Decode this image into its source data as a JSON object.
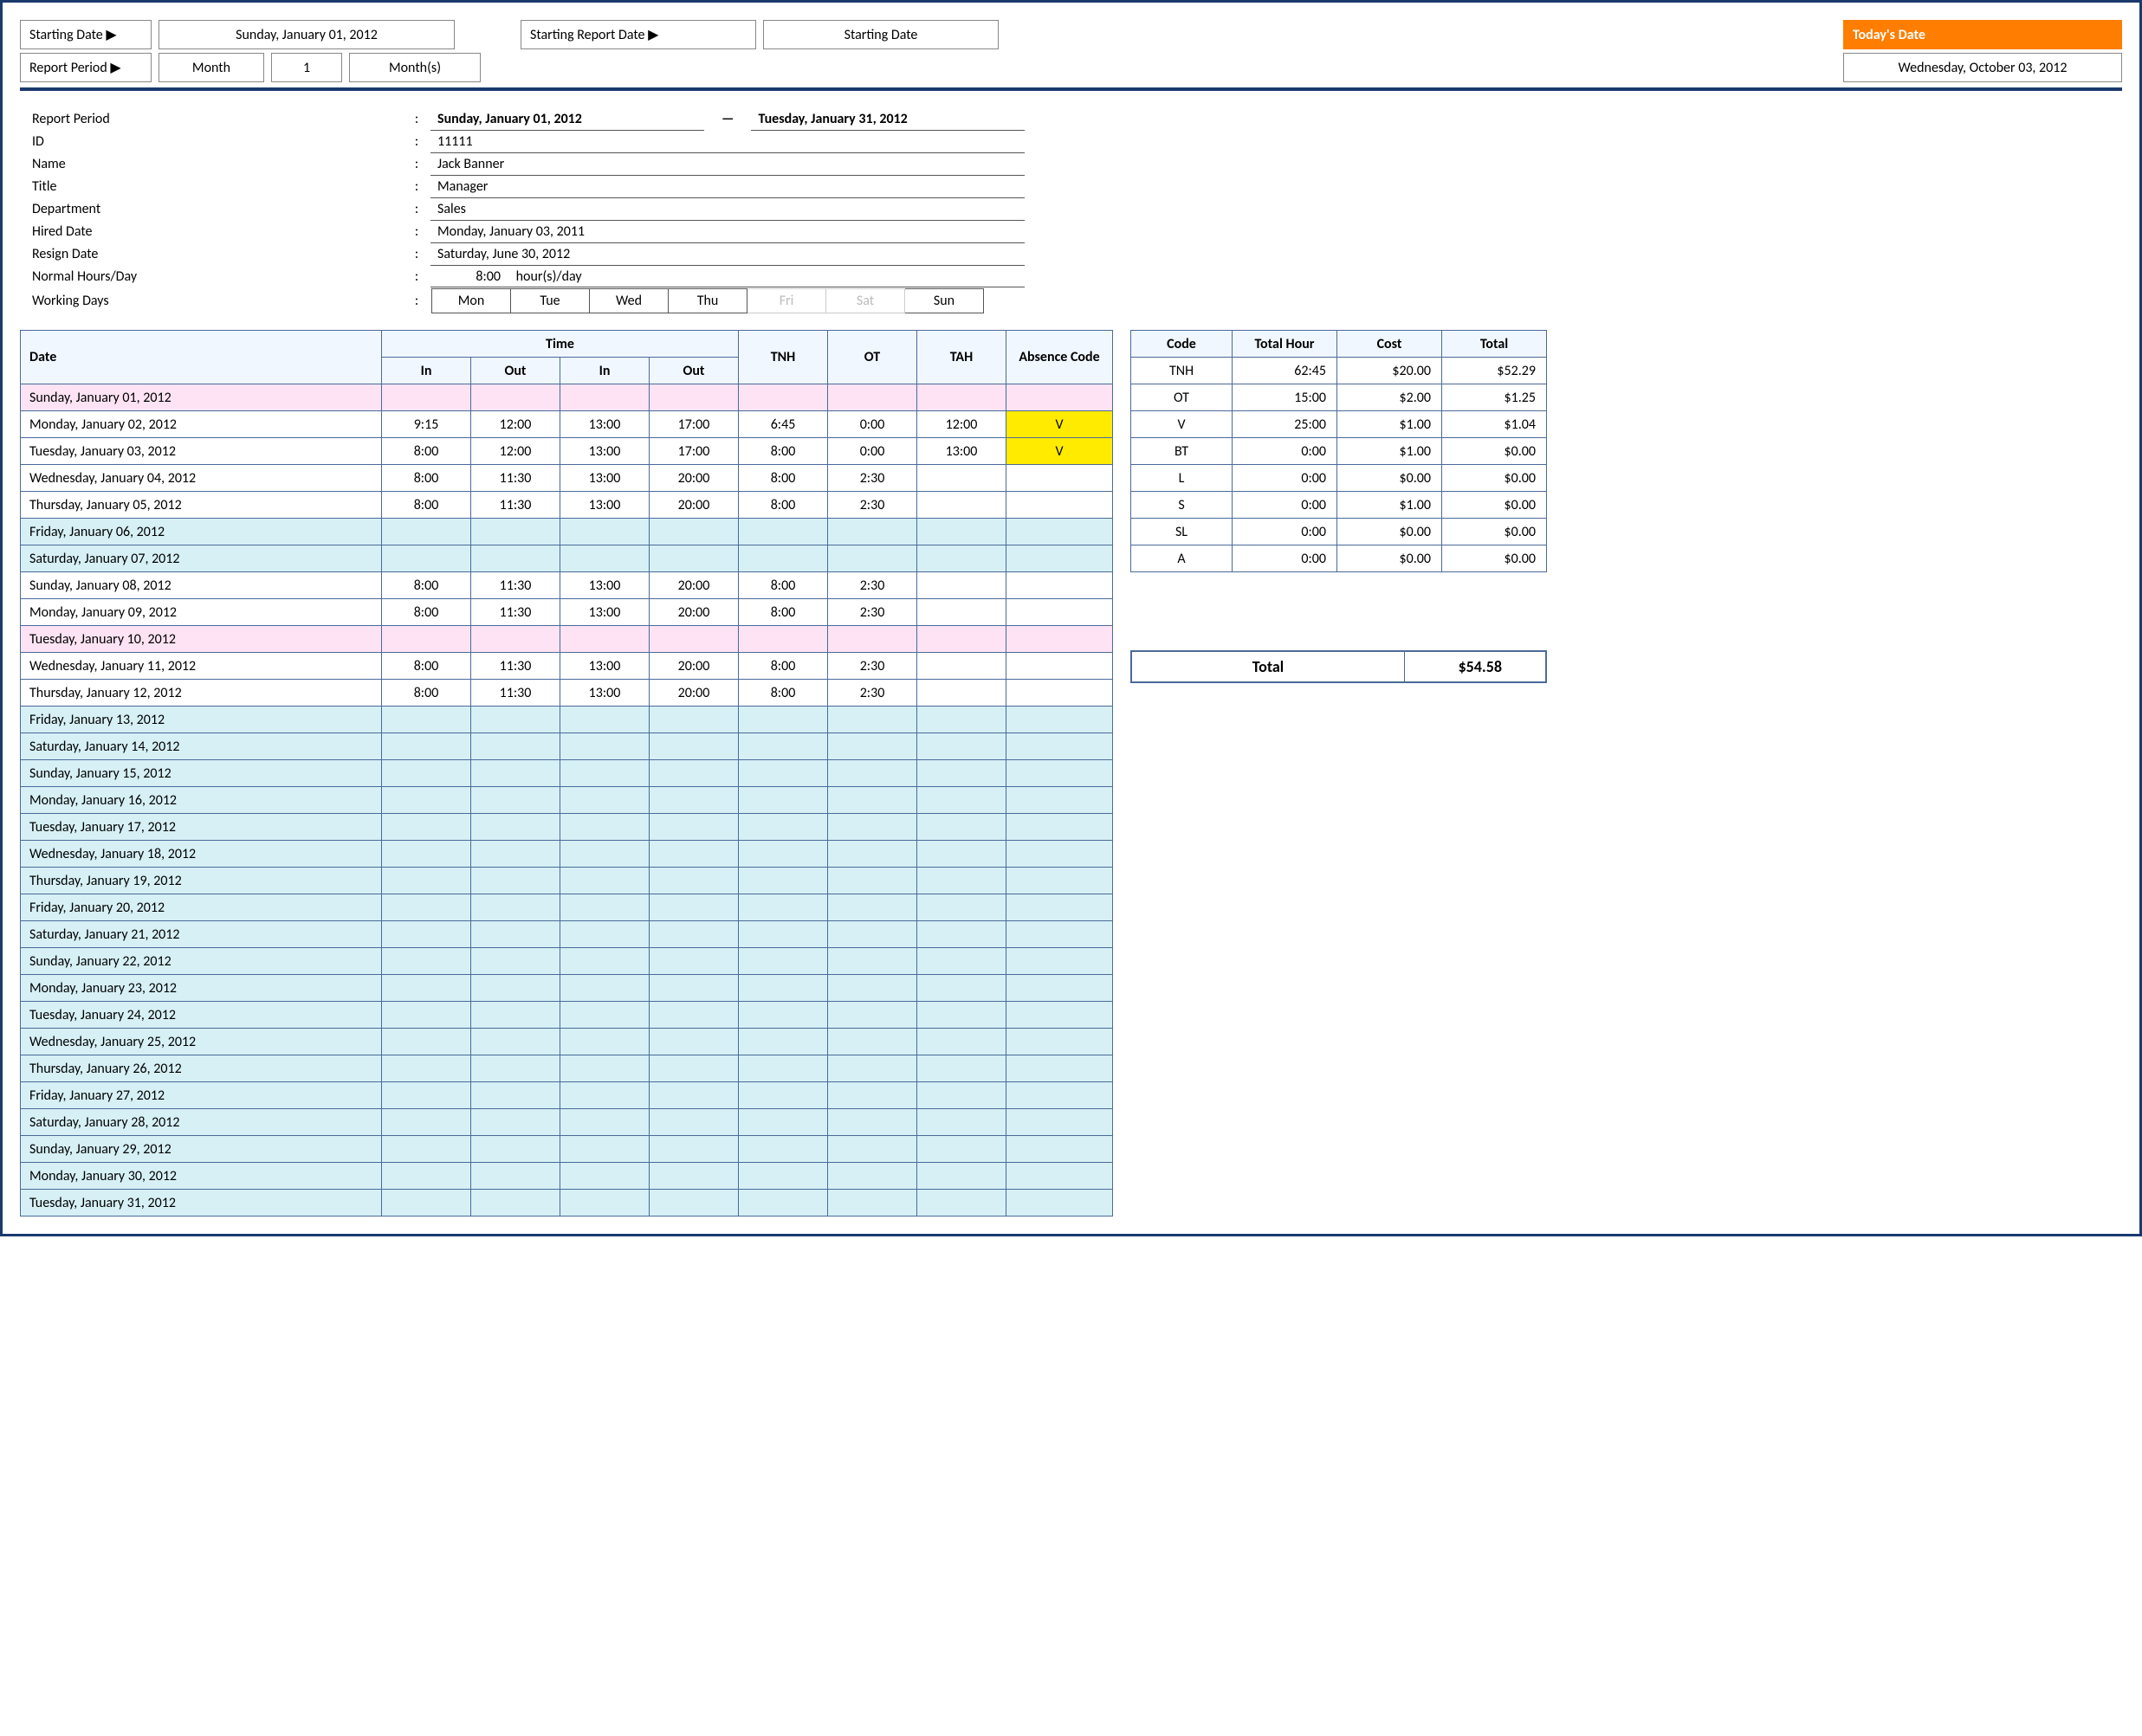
{
  "top": {
    "startLbl": "Starting Date ▶",
    "startVal": "Sunday, January 01, 2012",
    "reportDateLbl": "Starting Report Date ▶",
    "reportDateVal": "Starting Date",
    "periodLbl": "Report Period ▶",
    "periodUnit": "Month",
    "periodNum": "1",
    "periodSuffix": "Month(s)",
    "todayLbl": "Today's Date",
    "todayVal": "Wednesday, October 03, 2012"
  },
  "info": {
    "period_lbl": "Report Period",
    "period_from": "Sunday, January 01, 2012",
    "period_dash": "—",
    "period_to": "Tuesday, January 31, 2012",
    "id_lbl": "ID",
    "id_val": "11111",
    "name_lbl": "Name",
    "name_val": "Jack Banner",
    "title_lbl": "Title",
    "title_val": "Manager",
    "dept_lbl": "Department",
    "dept_val": "Sales",
    "hired_lbl": "Hired Date",
    "hired_val": "Monday, January 03, 2011",
    "resign_lbl": "Resign Date",
    "resign_val": "Saturday, June 30, 2012",
    "normhrs_lbl": "Normal Hours/Day",
    "normhrs_val": "8:00",
    "normhrs_unit": "hour(s)/day",
    "wd_lbl": "Working Days",
    "days": [
      "Mon",
      "Tue",
      "Wed",
      "Thu",
      "Fri",
      "Sat",
      "Sun"
    ]
  },
  "ts": {
    "hdr": {
      "date": "Date",
      "time": "Time",
      "in": "In",
      "out": "Out",
      "tnh": "TNH",
      "ot": "OT",
      "tah": "TAH",
      "abs": "Absence Code"
    },
    "rows": [
      {
        "d": "Sunday, January 01, 2012",
        "cls": "row-pink"
      },
      {
        "d": "Monday, January 02, 2012",
        "in1": "9:15",
        "out1": "12:00",
        "in2": "13:00",
        "out2": "17:00",
        "tnh": "6:45",
        "ot": "0:00",
        "tah": "12:00",
        "abs": "V",
        "yel": true
      },
      {
        "d": "Tuesday, January 03, 2012",
        "in1": "8:00",
        "out1": "12:00",
        "in2": "13:00",
        "out2": "17:00",
        "tnh": "8:00",
        "ot": "0:00",
        "tah": "13:00",
        "abs": "V",
        "yel": true
      },
      {
        "d": "Wednesday, January 04, 2012",
        "in1": "8:00",
        "out1": "11:30",
        "in2": "13:00",
        "out2": "20:00",
        "tnh": "8:00",
        "ot": "2:30"
      },
      {
        "d": "Thursday, January 05, 2012",
        "in1": "8:00",
        "out1": "11:30",
        "in2": "13:00",
        "out2": "20:00",
        "tnh": "8:00",
        "ot": "2:30"
      },
      {
        "d": "Friday, January 06, 2012",
        "cls": "row-cyan"
      },
      {
        "d": "Saturday, January 07, 2012",
        "cls": "row-cyan"
      },
      {
        "d": "Sunday, January 08, 2012",
        "in1": "8:00",
        "out1": "11:30",
        "in2": "13:00",
        "out2": "20:00",
        "tnh": "8:00",
        "ot": "2:30"
      },
      {
        "d": "Monday, January 09, 2012",
        "in1": "8:00",
        "out1": "11:30",
        "in2": "13:00",
        "out2": "20:00",
        "tnh": "8:00",
        "ot": "2:30"
      },
      {
        "d": "Tuesday, January 10, 2012",
        "cls": "row-pink"
      },
      {
        "d": "Wednesday, January 11, 2012",
        "in1": "8:00",
        "out1": "11:30",
        "in2": "13:00",
        "out2": "20:00",
        "tnh": "8:00",
        "ot": "2:30"
      },
      {
        "d": "Thursday, January 12, 2012",
        "in1": "8:00",
        "out1": "11:30",
        "in2": "13:00",
        "out2": "20:00",
        "tnh": "8:00",
        "ot": "2:30"
      },
      {
        "d": "Friday, January 13, 2012",
        "cls": "row-cyan"
      },
      {
        "d": "Saturday, January 14, 2012",
        "cls": "row-cyan"
      },
      {
        "d": "Sunday, January 15, 2012",
        "cls": "row-cyan"
      },
      {
        "d": "Monday, January 16, 2012",
        "cls": "row-cyan"
      },
      {
        "d": "Tuesday, January 17, 2012",
        "cls": "row-cyan"
      },
      {
        "d": "Wednesday, January 18, 2012",
        "cls": "row-cyan"
      },
      {
        "d": "Thursday, January 19, 2012",
        "cls": "row-cyan"
      },
      {
        "d": "Friday, January 20, 2012",
        "cls": "row-cyan"
      },
      {
        "d": "Saturday, January 21, 2012",
        "cls": "row-cyan"
      },
      {
        "d": "Sunday, January 22, 2012",
        "cls": "row-cyan"
      },
      {
        "d": "Monday, January 23, 2012",
        "cls": "row-cyan"
      },
      {
        "d": "Tuesday, January 24, 2012",
        "cls": "row-cyan"
      },
      {
        "d": "Wednesday, January 25, 2012",
        "cls": "row-cyan"
      },
      {
        "d": "Thursday, January 26, 2012",
        "cls": "row-cyan"
      },
      {
        "d": "Friday, January 27, 2012",
        "cls": "row-cyan"
      },
      {
        "d": "Saturday, January 28, 2012",
        "cls": "row-cyan"
      },
      {
        "d": "Sunday, January 29, 2012",
        "cls": "row-cyan"
      },
      {
        "d": "Monday, January 30, 2012",
        "cls": "row-cyan"
      },
      {
        "d": "Tuesday, January 31, 2012",
        "cls": "row-cyan"
      }
    ]
  },
  "sum": {
    "hdr": {
      "code": "Code",
      "hour": "Total Hour",
      "cost": "Cost",
      "total": "Total"
    },
    "rows": [
      {
        "c": "TNH",
        "h": "62:45",
        "cost": "$20.00",
        "t": "$52.29"
      },
      {
        "c": "OT",
        "h": "15:00",
        "cost": "$2.00",
        "t": "$1.25"
      },
      {
        "c": "V",
        "h": "25:00",
        "cost": "$1.00",
        "t": "$1.04"
      },
      {
        "c": "BT",
        "h": "0:00",
        "cost": "$1.00",
        "t": "$0.00"
      },
      {
        "c": "L",
        "h": "0:00",
        "cost": "$0.00",
        "t": "$0.00"
      },
      {
        "c": "S",
        "h": "0:00",
        "cost": "$1.00",
        "t": "$0.00"
      },
      {
        "c": "SL",
        "h": "0:00",
        "cost": "$0.00",
        "t": "$0.00"
      },
      {
        "c": "A",
        "h": "0:00",
        "cost": "$0.00",
        "t": "$0.00"
      }
    ],
    "grand_lbl": "Total",
    "grand_val": "$54.58"
  }
}
